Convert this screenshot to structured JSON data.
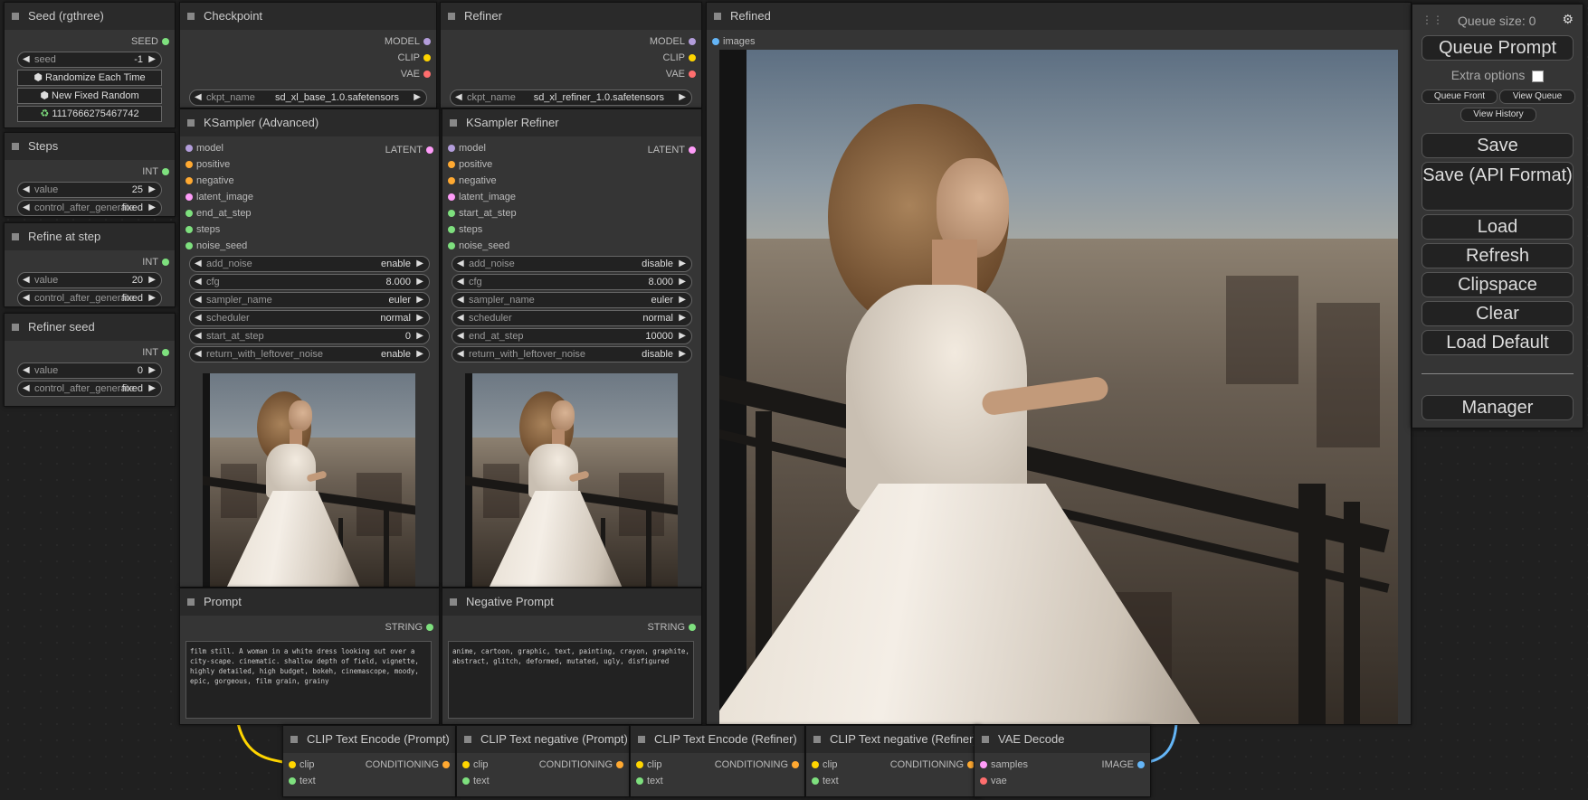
{
  "seed_node": {
    "title": "Seed (rgthree)",
    "out": "SEED",
    "seed_label": "seed",
    "seed_value": "-1",
    "btn_random": "Randomize Each Time",
    "btn_fixed": "New Fixed Random",
    "last_seed": "1117666275467742",
    "dice_icon": "dice-icon",
    "recycle_icon": "recycle-icon"
  },
  "steps_node": {
    "title": "Steps",
    "out": "INT",
    "value_label": "value",
    "value": "25",
    "control_label": "control_after_generate",
    "control_value": "fixed"
  },
  "refine_step_node": {
    "title": "Refine at step",
    "out": "INT",
    "value_label": "value",
    "value": "20",
    "control_label": "control_after_generate",
    "control_value": "fixed"
  },
  "refiner_seed_node": {
    "title": "Refiner seed",
    "out": "INT",
    "value_label": "value",
    "value": "0",
    "control_label": "control_after_generate",
    "control_value": "fixed"
  },
  "checkpoint_node": {
    "title": "Checkpoint",
    "outs": [
      "MODEL",
      "CLIP",
      "VAE"
    ],
    "ckpt_label": "ckpt_name",
    "ckpt_value": "sd_xl_base_1.0.safetensors"
  },
  "refiner_node": {
    "title": "Refiner",
    "outs": [
      "MODEL",
      "CLIP",
      "VAE"
    ],
    "ckpt_label": "ckpt_name",
    "ckpt_value": "sd_xl_refiner_1.0.safetensors"
  },
  "ksampler_adv": {
    "title": "KSampler (Advanced)",
    "out": "LATENT",
    "inputs": [
      "model",
      "positive",
      "negative",
      "latent_image",
      "end_at_step",
      "steps",
      "noise_seed"
    ],
    "widgets": [
      {
        "label": "add_noise",
        "value": "enable"
      },
      {
        "label": "cfg",
        "value": "8.000"
      },
      {
        "label": "sampler_name",
        "value": "euler"
      },
      {
        "label": "scheduler",
        "value": "normal"
      },
      {
        "label": "start_at_step",
        "value": "0"
      },
      {
        "label": "return_with_leftover_noise",
        "value": "enable"
      }
    ]
  },
  "ksampler_ref": {
    "title": "KSampler Refiner",
    "out": "LATENT",
    "inputs": [
      "model",
      "positive",
      "negative",
      "latent_image",
      "start_at_step",
      "steps",
      "noise_seed"
    ],
    "widgets": [
      {
        "label": "add_noise",
        "value": "disable"
      },
      {
        "label": "cfg",
        "value": "8.000"
      },
      {
        "label": "sampler_name",
        "value": "euler"
      },
      {
        "label": "scheduler",
        "value": "normal"
      },
      {
        "label": "end_at_step",
        "value": "10000"
      },
      {
        "label": "return_with_leftover_noise",
        "value": "disable"
      }
    ]
  },
  "prompt_node": {
    "title": "Prompt",
    "out": "STRING",
    "text": "film still. A woman in a white dress looking out over a city-scape. cinematic. shallow depth of field, vignette, highly detailed, high budget, bokeh, cinemascope, moody, epic, gorgeous, film grain, grainy"
  },
  "neg_prompt_node": {
    "title": "Negative Prompt",
    "out": "STRING",
    "text": "anime, cartoon, graphic, text, painting, crayon, graphite, abstract, glitch, deformed, mutated, ugly, disfigured"
  },
  "refined_node": {
    "title": "Refined",
    "input": "images"
  },
  "bottom_nodes": [
    {
      "title": "CLIP Text Encode (Prompt)",
      "in1": "clip",
      "in2": "text",
      "out": "CONDITIONING"
    },
    {
      "title": "CLIP Text negative (Prompt)",
      "in1": "clip",
      "in2": "text",
      "out": "CONDITIONING"
    },
    {
      "title": "CLIP Text Encode (Refiner)",
      "in1": "clip",
      "in2": "text",
      "out": "CONDITIONING"
    },
    {
      "title": "CLIP Text negative (Refiner)",
      "in1": "clip",
      "in2": "text",
      "out": "CONDITIONING"
    },
    {
      "title": "VAE Decode",
      "in1": "samples",
      "in2": "vae",
      "out": "IMAGE"
    }
  ],
  "menu": {
    "queue_size": "Queue size: 0",
    "queue_prompt": "Queue Prompt",
    "extra_options": "Extra options",
    "queue_front": "Queue Front",
    "view_queue": "View Queue",
    "view_history": "View History",
    "save": "Save",
    "save_api": "Save (API Format)",
    "load": "Load",
    "refresh": "Refresh",
    "clipspace": "Clipspace",
    "clear": "Clear",
    "load_default": "Load Default",
    "manager": "Manager"
  },
  "colors": {
    "model": "#b39ddb",
    "clip": "#ffd500",
    "vae": "#ff6e6e",
    "latent": "#ff9cf9",
    "int": "#7ee07e",
    "cond": "#ffa931",
    "image": "#64b5f6",
    "seed": "#7ee07e"
  }
}
